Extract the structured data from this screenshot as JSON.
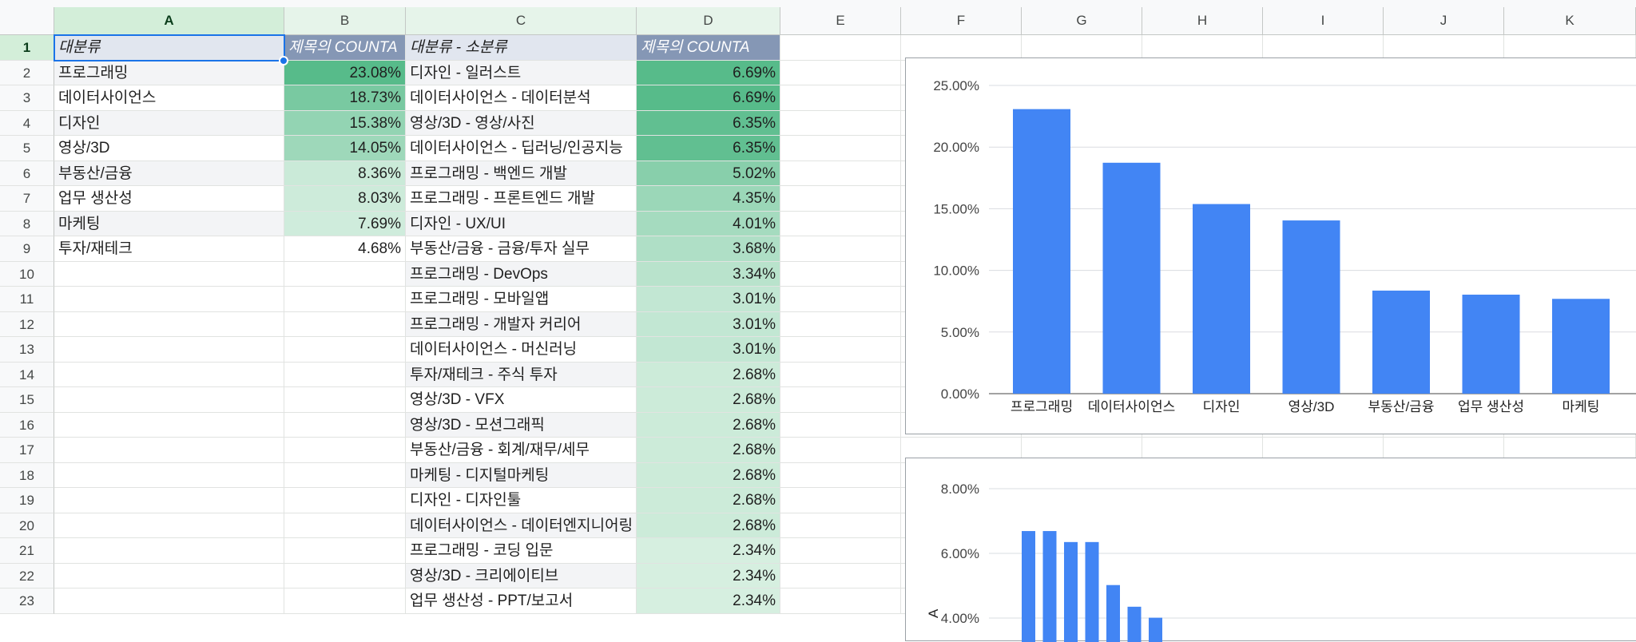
{
  "columns": [
    "A",
    "B",
    "C",
    "D",
    "E",
    "F",
    "G",
    "H",
    "I",
    "J",
    "K"
  ],
  "rows": [
    "1",
    "2",
    "3",
    "4",
    "5",
    "6",
    "7",
    "8",
    "9",
    "10",
    "11",
    "12",
    "13",
    "14",
    "15",
    "16",
    "17",
    "18",
    "19",
    "20",
    "21",
    "22",
    "23"
  ],
  "header": {
    "a": "대분류",
    "b": "제목의 COUNTA",
    "c": "대분류 - 소분류",
    "d": "제목의 COUNTA"
  },
  "left_table": [
    {
      "name": "프로그래밍",
      "pct": "23.08%"
    },
    {
      "name": "데이터사이언스",
      "pct": "18.73%"
    },
    {
      "name": "디자인",
      "pct": "15.38%"
    },
    {
      "name": "영상/3D",
      "pct": "14.05%"
    },
    {
      "name": "부동산/금융",
      "pct": "8.36%"
    },
    {
      "name": "업무 생산성",
      "pct": "8.03%"
    },
    {
      "name": "마케팅",
      "pct": "7.69%"
    },
    {
      "name": "투자/재테크",
      "pct": "4.68%"
    }
  ],
  "right_table": [
    {
      "name": "디자인 - 일러스트",
      "pct": "6.69%"
    },
    {
      "name": "데이터사이언스 - 데이터분석",
      "pct": "6.69%"
    },
    {
      "name": "영상/3D - 영상/사진",
      "pct": "6.35%"
    },
    {
      "name": "데이터사이언스 - 딥러닝/인공지능",
      "pct": "6.35%"
    },
    {
      "name": "프로그래밍 - 백엔드 개발",
      "pct": "5.02%"
    },
    {
      "name": "프로그래밍 - 프론트엔드 개발",
      "pct": "4.35%"
    },
    {
      "name": "디자인 - UX/UI",
      "pct": "4.01%"
    },
    {
      "name": "부동산/금융 - 금융/투자 실무",
      "pct": "3.68%"
    },
    {
      "name": "프로그래밍 - DevOps",
      "pct": "3.34%"
    },
    {
      "name": "프로그래밍 - 모바일앱",
      "pct": "3.01%"
    },
    {
      "name": "프로그래밍 - 개발자 커리어",
      "pct": "3.01%"
    },
    {
      "name": "데이터사이언스 - 머신러닝",
      "pct": "3.01%"
    },
    {
      "name": "투자/재테크 - 주식 투자",
      "pct": "2.68%"
    },
    {
      "name": "영상/3D - VFX",
      "pct": "2.68%"
    },
    {
      "name": "영상/3D - 모션그래픽",
      "pct": "2.68%"
    },
    {
      "name": "부동산/금융 - 회계/재무/세무",
      "pct": "2.68%"
    },
    {
      "name": "마케팅 - 디지털마케팅",
      "pct": "2.68%"
    },
    {
      "name": "디자인 - 디자인툴",
      "pct": "2.68%"
    },
    {
      "name": "데이터사이언스 - 데이터엔지니어링",
      "pct": "2.68%"
    },
    {
      "name": "프로그래밍 - 코딩 입문",
      "pct": "2.34%"
    },
    {
      "name": "영상/3D - 크리에이티브",
      "pct": "2.34%"
    },
    {
      "name": "업무 생산성 - PPT/보고서",
      "pct": "2.34%"
    }
  ],
  "colors": {
    "bar": "#4285f4",
    "selection": "#1a73e8",
    "header_d": "#8597b5",
    "header_a": "#e1e6ef"
  },
  "chart_data": [
    {
      "type": "bar",
      "categories": [
        "프로그래밍",
        "데이터사이언스",
        "디자인",
        "영상/3D",
        "부동산/금융",
        "업무 생산성",
        "마케팅"
      ],
      "values": [
        23.08,
        18.73,
        15.38,
        14.05,
        8.36,
        8.03,
        7.69
      ],
      "yticks": [
        "0.00%",
        "5.00%",
        "10.00%",
        "15.00%",
        "20.00%",
        "25.00%"
      ],
      "ylim": [
        0,
        25
      ],
      "grid": true
    },
    {
      "type": "bar",
      "values": [
        6.69,
        6.69,
        6.35,
        6.35,
        5.02,
        4.35,
        4.01
      ],
      "yticks": [
        "4.00%",
        "6.00%",
        "8.00%"
      ],
      "ylim": [
        4,
        8
      ],
      "ylabel": "A",
      "grid": true
    }
  ]
}
